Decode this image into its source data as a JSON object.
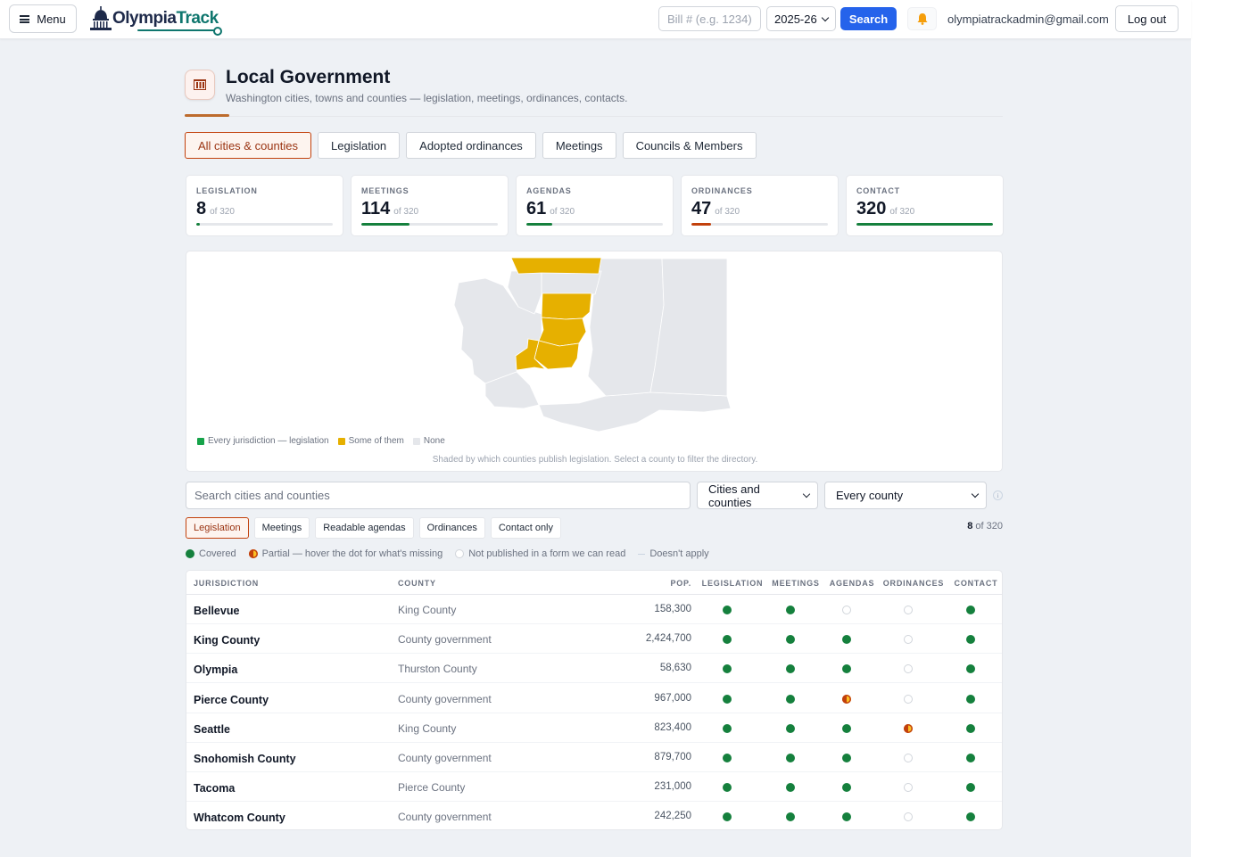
{
  "header": {
    "menu_label": "Menu",
    "logo": {
      "part1": "Olympia",
      "part2": "Track"
    },
    "bill_placeholder": "Bill # (e.g. 1234)",
    "session": "2025-26",
    "search_label": "Search",
    "notifications_icon": "bell-icon",
    "user_email": "olympiatrackadmin@gmail.com",
    "logout_label": "Log out"
  },
  "page": {
    "icon": "building-icon",
    "title": "Local Government",
    "subtitle": "Washington cities, towns and counties — legislation, meetings, ordinances, contacts."
  },
  "tabs": [
    {
      "label": "All cities & counties",
      "active": true
    },
    {
      "label": "Legislation",
      "active": false
    },
    {
      "label": "Adopted ordinances",
      "active": false
    },
    {
      "label": "Meetings",
      "active": false
    },
    {
      "label": "Councils & Members",
      "active": false
    }
  ],
  "stats": [
    {
      "label": "LEGISLATION",
      "value": "8",
      "of": "of 320",
      "fraction": 0.025,
      "color": "#15803d"
    },
    {
      "label": "MEETINGS",
      "value": "114",
      "of": "of 320",
      "fraction": 0.356,
      "color": "#15803d"
    },
    {
      "label": "AGENDAS",
      "value": "61",
      "of": "of 320",
      "fraction": 0.19,
      "color": "#15803d"
    },
    {
      "label": "ORDINANCES",
      "value": "47",
      "of": "of 320",
      "fraction": 0.147,
      "color": "#c2410c"
    },
    {
      "label": "CONTACT",
      "value": "320",
      "of": "of 320",
      "fraction": 1.0,
      "color": "#15803d"
    }
  ],
  "map": {
    "colors": {
      "every": "#16a34a",
      "some": "#e6b000",
      "none": "#e5e7eb"
    },
    "legend": [
      {
        "label": "Every jurisdiction — legislation",
        "color": "#16a34a"
      },
      {
        "label": "Some of them",
        "color": "#e6b000"
      },
      {
        "label": "None",
        "color": "#e5e7eb"
      }
    ],
    "caption": "Shaded by which counties publish legislation. Select a county to filter the directory."
  },
  "filters": {
    "search_placeholder": "Search cities and counties",
    "type_selected": "Cities and counties",
    "county_selected": "Every county",
    "chips": [
      {
        "label": "Legislation",
        "active": true
      },
      {
        "label": "Meetings",
        "active": false
      },
      {
        "label": "Readable agendas",
        "active": false
      },
      {
        "label": "Ordinances",
        "active": false
      },
      {
        "label": "Contact only",
        "active": false
      }
    ],
    "count_value": "8",
    "count_of": "of 320"
  },
  "status_key": [
    {
      "type": "full",
      "label": "Covered"
    },
    {
      "type": "part",
      "label": "Partial — hover the dot for what's missing"
    },
    {
      "type": "none",
      "label": "Not published in a form we can read"
    },
    {
      "type": "na",
      "label": "Doesn't apply"
    }
  ],
  "table": {
    "columns": [
      "JURISDICTION",
      "COUNTY",
      "POP.",
      "LEGISLATION",
      "MEETINGS",
      "AGENDAS",
      "ORDINANCES",
      "CONTACT"
    ],
    "rows": [
      {
        "name": "Bellevue",
        "county": "King County",
        "pop": "158,300",
        "status": [
          "full",
          "full",
          "none",
          "none",
          "full"
        ]
      },
      {
        "name": "King County",
        "county": "County government",
        "pop": "2,424,700",
        "status": [
          "full",
          "full",
          "full",
          "none",
          "full"
        ]
      },
      {
        "name": "Olympia",
        "county": "Thurston County",
        "pop": "58,630",
        "status": [
          "full",
          "full",
          "full",
          "none",
          "full"
        ]
      },
      {
        "name": "Pierce County",
        "county": "County government",
        "pop": "967,000",
        "status": [
          "full",
          "full",
          "part",
          "none",
          "full"
        ]
      },
      {
        "name": "Seattle",
        "county": "King County",
        "pop": "823,400",
        "status": [
          "full",
          "full",
          "full",
          "part",
          "full"
        ]
      },
      {
        "name": "Snohomish County",
        "county": "County government",
        "pop": "879,700",
        "status": [
          "full",
          "full",
          "full",
          "none",
          "full"
        ]
      },
      {
        "name": "Tacoma",
        "county": "Pierce County",
        "pop": "231,000",
        "status": [
          "full",
          "full",
          "full",
          "none",
          "full"
        ]
      },
      {
        "name": "Whatcom County",
        "county": "County government",
        "pop": "242,250",
        "status": [
          "full",
          "full",
          "full",
          "none",
          "full"
        ]
      }
    ]
  }
}
